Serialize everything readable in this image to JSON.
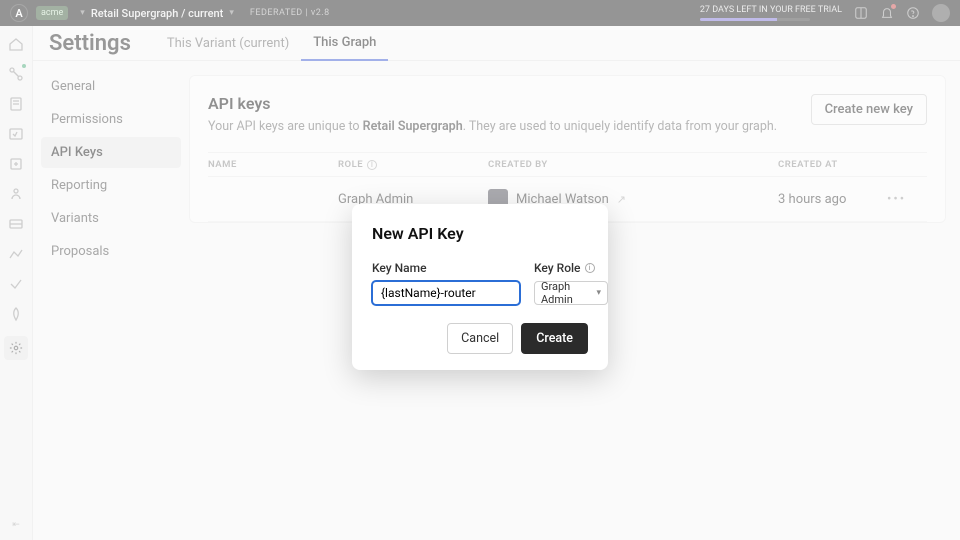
{
  "top": {
    "org_badge": "acme",
    "graph_name": "Retail Supergraph / current",
    "fed_label": "FEDERATED",
    "fed_ver": "v2.8",
    "trial": "27 DAYS LEFT IN YOUR FREE TRIAL"
  },
  "header": {
    "title": "Settings",
    "tab_variant": "This Variant (current)",
    "tab_graph": "This Graph"
  },
  "sidebar": {
    "items": [
      "General",
      "Permissions",
      "API Keys",
      "Reporting",
      "Variants",
      "Proposals"
    ]
  },
  "panel": {
    "title": "API keys",
    "desc_pre": "Your API keys are unique to ",
    "desc_bold": "Retail Supergraph",
    "desc_post": ". They are used to uniquely identify data from your graph.",
    "create_btn": "Create new key",
    "cols": {
      "name": "NAME",
      "role": "ROLE",
      "by": "CREATED BY",
      "at": "CREATED AT"
    },
    "row": {
      "role": "Graph Admin",
      "by": "Michael Watson",
      "at": "3 hours ago"
    }
  },
  "modal": {
    "title": "New API Key",
    "name_label": "Key Name",
    "role_label": "Key Role",
    "name_value": "{lastName}-router",
    "role_value": "Graph Admin",
    "cancel": "Cancel",
    "create": "Create"
  }
}
